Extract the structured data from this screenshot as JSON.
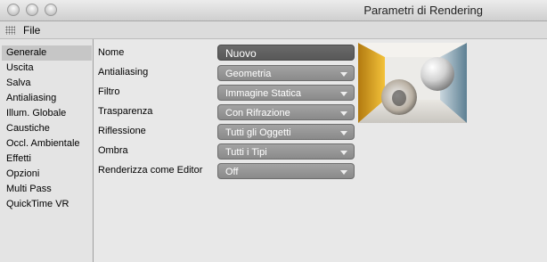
{
  "window": {
    "title": "Parametri di Rendering"
  },
  "menu": {
    "file_label": "File"
  },
  "sidebar": {
    "items": [
      {
        "label": "Generale",
        "selected": true
      },
      {
        "label": "Uscita"
      },
      {
        "label": "Salva"
      },
      {
        "label": "Antialiasing"
      },
      {
        "label": "Illum. Globale"
      },
      {
        "label": "Caustiche"
      },
      {
        "label": "Occl. Ambientale"
      },
      {
        "label": "Effetti"
      },
      {
        "label": "Opzioni"
      },
      {
        "label": "Multi Pass"
      },
      {
        "label": "QuickTime VR"
      }
    ]
  },
  "settings": {
    "nome": {
      "label": "Nome",
      "value": "Nuovo"
    },
    "antialiasing": {
      "label": "Antialiasing",
      "value": "Geometria"
    },
    "filtro": {
      "label": "Filtro",
      "value": "Immagine Statica"
    },
    "trasparenza": {
      "label": "Trasparenza",
      "value": "Con Rifrazione"
    },
    "riflessione": {
      "label": "Riflessione",
      "value": "Tutti gli Oggetti"
    },
    "ombra": {
      "label": "Ombra",
      "value": "Tutti i Tipi"
    },
    "renderizza": {
      "label": "Renderizza come Editor",
      "value": "Off"
    }
  },
  "colors": {
    "sidebar_selected": "#c6c6c6",
    "field_dark": "#5f5f5f",
    "dropdown": "#999999"
  }
}
